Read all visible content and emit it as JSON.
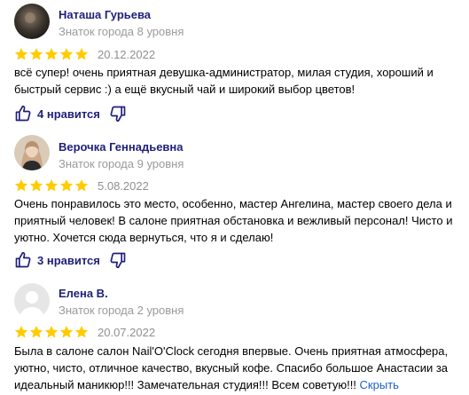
{
  "reviews": [
    {
      "author": "Наташа Гурьева",
      "level": "Знаток города 8 уровня",
      "rating": 5,
      "date": "20.12.2022",
      "text": "всё супер! очень приятная девушка-администратор, милая студия, хороший и быстрый сервис :) а ещё вкусный чай и широкий выбор цветов!",
      "likes_label": "4 нравится",
      "avatar_icon": "dark-photo-avatar"
    },
    {
      "author": "Верочка Геннадьевна",
      "level": "Знаток города 9 уровня",
      "rating": 5,
      "date": "5.08.2022",
      "text": "Очень понравилось это место, особенно, мастер Ангелина, мастер своего дела и приятный человек! В салоне приятная обстановка и вежливый персонал! Чисто и уютно. Хочется сюда вернуться, что я и сделаю!",
      "likes_label": "3 нравится",
      "avatar_icon": "woman-photo-avatar"
    },
    {
      "author": "Елена В.",
      "level": "Знаток города 2 уровня",
      "rating": 5,
      "date": "20.07.2022",
      "text": "Была в салоне салон Nail'O'Clock сегодня впервые. Очень приятная атмосфера, уютно, чисто, отличное качество, вкусный кофе. Спасибо большое Анастасии за идеальный маникюр!!! Замечательная студия!!! Всем советую!!!",
      "expand_label": "Скрыть",
      "avatar_icon": "default-user-avatar"
    }
  ],
  "colors": {
    "star": "#fc0",
    "name": "#1f1f7a",
    "muted": "#9a9a9a",
    "link": "#1a5fd1",
    "icon": "#1f1f7a"
  }
}
